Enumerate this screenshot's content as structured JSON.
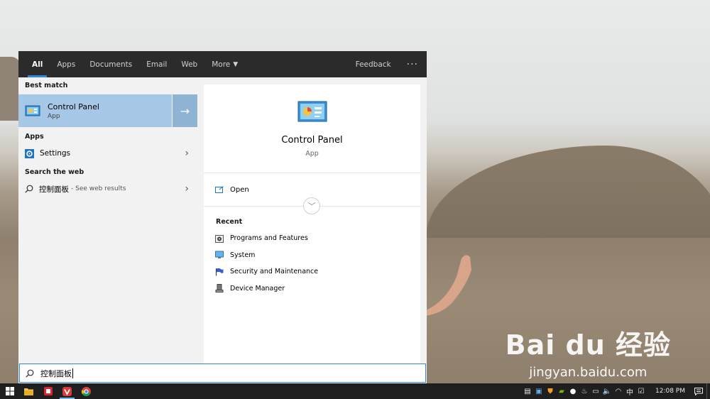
{
  "tabs": [
    {
      "label": "All",
      "active": true
    },
    {
      "label": "Apps"
    },
    {
      "label": "Documents"
    },
    {
      "label": "Email"
    },
    {
      "label": "Web"
    },
    {
      "label": "More"
    }
  ],
  "header": {
    "feedback": "Feedback",
    "more_options": "···"
  },
  "left": {
    "best_match_label": "Best match",
    "best_match": {
      "title": "Control Panel",
      "subtitle": "App"
    },
    "apps_label": "Apps",
    "apps": [
      {
        "label": "Settings"
      }
    ],
    "web_label": "Search the web",
    "web_result": {
      "query": "控制面板",
      "suffix": "- See web results"
    }
  },
  "preview": {
    "title": "Control Panel",
    "subtitle": "App",
    "open_label": "Open",
    "recent_label": "Recent",
    "recent": [
      {
        "label": "Programs and Features",
        "icon": "programs-features-icon"
      },
      {
        "label": "System",
        "icon": "system-monitor-icon"
      },
      {
        "label": "Security and Maintenance",
        "icon": "security-flag-icon"
      },
      {
        "label": "Device Manager",
        "icon": "device-manager-icon"
      }
    ]
  },
  "search": {
    "value": "控制面板"
  },
  "taskbar": {
    "apps": [
      "windows-start-icon",
      "file-explorer-icon",
      "red-app-icon",
      "vivaldi-icon",
      "chrome-icon"
    ],
    "tray": {
      "ime": "中",
      "time": "12:08 PM"
    }
  },
  "watermark": {
    "brand": "Bai du 经验",
    "url": "jingyan.baidu.com"
  },
  "colors": {
    "accent": "#2e86de",
    "selection": "#a6c8e6",
    "tab_bar": "#2b2b2b"
  }
}
